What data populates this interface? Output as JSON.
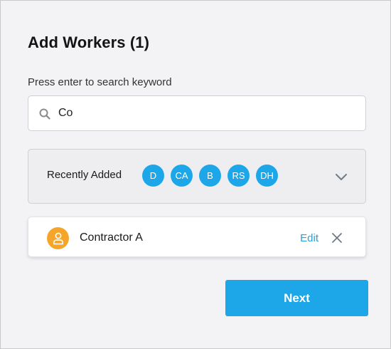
{
  "dialog": {
    "title": "Add Workers (1)"
  },
  "search": {
    "label": "Press enter to search keyword",
    "value": "Co",
    "icon": "search-icon"
  },
  "recent": {
    "label": "Recently Added",
    "chips": [
      "D",
      "CA",
      "B",
      "RS",
      "DH"
    ],
    "chip_color": "#1ea7e8",
    "expand_icon": "chevron-down-icon"
  },
  "selected_workers": [
    {
      "name": "Contractor A",
      "avatar_icon": "person-icon",
      "avatar_color": "#f4a52a",
      "edit_label": "Edit",
      "remove_icon": "close-icon"
    }
  ],
  "actions": {
    "next_label": "Next",
    "accent": "#1ea7e8"
  }
}
